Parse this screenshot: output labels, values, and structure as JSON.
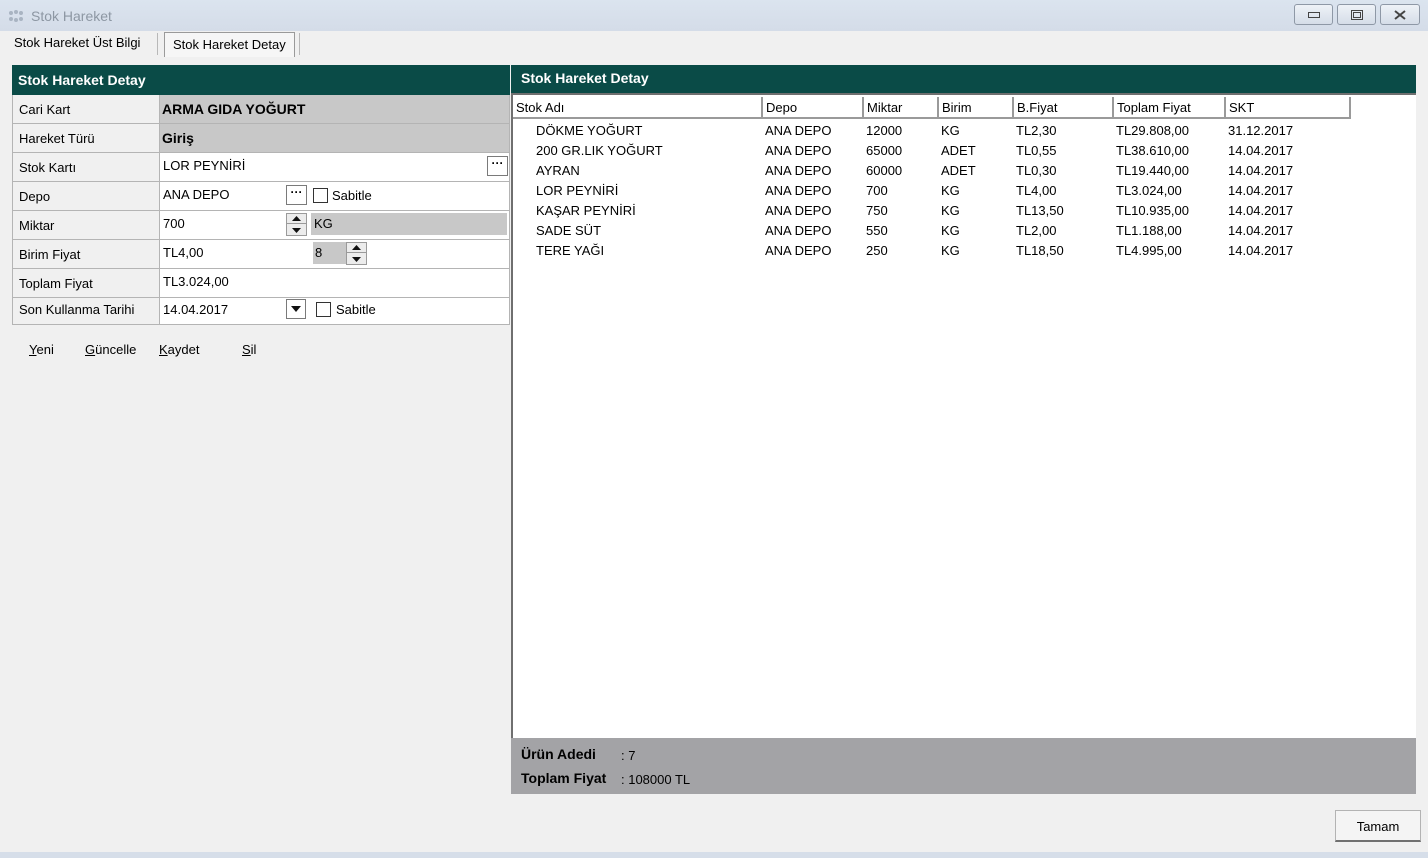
{
  "window": {
    "title": "Stok Hareket"
  },
  "tabs": [
    {
      "label": "Stok Hareket Üst Bilgi"
    },
    {
      "label": "Stok Hareket Detay"
    }
  ],
  "form": {
    "header": "Stok Hareket Detay",
    "cari_kart": {
      "label": "Cari Kart",
      "value": "ARMA GIDA YOĞURT"
    },
    "hareket_turu": {
      "label": "Hareket Türü",
      "value": "Giriş"
    },
    "stok_karti": {
      "label": "Stok Kartı",
      "value": "LOR PEYNİRİ",
      "button": "···"
    },
    "depo": {
      "label": "Depo",
      "value": "ANA DEPO",
      "button": "···",
      "checkbox_label": "Sabitle"
    },
    "miktar": {
      "label": "Miktar",
      "value": "700",
      "unit": "KG"
    },
    "birim_fiyat": {
      "label": "Birim Fiyat",
      "value": "TL4,00",
      "kdv": "8"
    },
    "toplam_fiyat": {
      "label": "Toplam Fiyat",
      "value": "TL3.024,00"
    },
    "son_kullanma": {
      "label": "Son Kullanma Tarihi",
      "value": "14.04.2017",
      "checkbox_label": "Sabitle"
    },
    "actions": {
      "yeni": {
        "key": "Y",
        "rest": "eni"
      },
      "guncelle": {
        "key": "G",
        "rest": "üncelle"
      },
      "kaydet": {
        "key": "K",
        "rest": "aydet"
      },
      "sil": {
        "key": "S",
        "rest": "il"
      }
    }
  },
  "grid": {
    "header": "Stok Hareket Detay",
    "columns": [
      "Stok Adı",
      "Depo",
      "Miktar",
      "Birim",
      "B.Fiyat",
      "Toplam Fiyat",
      "SKT"
    ],
    "rows": [
      [
        "DÖKME YOĞURT",
        "ANA DEPO",
        "12000",
        "KG",
        "TL2,30",
        "TL29.808,00",
        "31.12.2017"
      ],
      [
        "200 GR.LIK YOĞURT",
        "ANA DEPO",
        "65000",
        "ADET",
        "TL0,55",
        "TL38.610,00",
        "14.04.2017"
      ],
      [
        "AYRAN",
        "ANA DEPO",
        "60000",
        "ADET",
        "TL0,30",
        "TL19.440,00",
        "14.04.2017"
      ],
      [
        "LOR PEYNİRİ",
        "ANA DEPO",
        "700",
        "KG",
        "TL4,00",
        "TL3.024,00",
        "14.04.2017"
      ],
      [
        "KAŞAR PEYNİRİ",
        "ANA DEPO",
        "750",
        "KG",
        "TL13,50",
        "TL10.935,00",
        "14.04.2017"
      ],
      [
        "SADE SÜT",
        "ANA DEPO",
        "550",
        "KG",
        "TL2,00",
        "TL1.188,00",
        "14.04.2017"
      ],
      [
        "TERE YAĞI",
        "ANA DEPO",
        "250",
        "KG",
        "TL18,50",
        "TL4.995,00",
        "14.04.2017"
      ]
    ]
  },
  "summary": {
    "urun_adedi_label": "Ürün Adedi",
    "urun_adedi_value": ": 7",
    "toplam_fiyat_label": "Toplam Fiyat",
    "toplam_fiyat_value": ": 108000 TL"
  },
  "ok_button": "Tamam",
  "colors": {
    "header_bg": "#0a4b47",
    "summary_bg": "#a3a3a6"
  }
}
